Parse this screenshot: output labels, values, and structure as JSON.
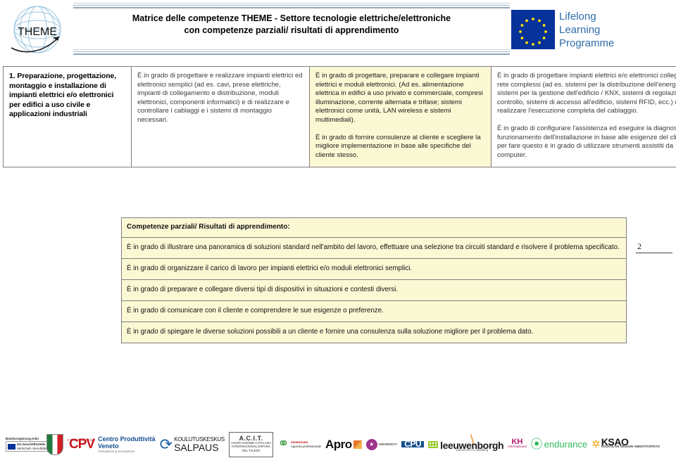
{
  "header": {
    "logo_label": "THEME",
    "title_line1": "Matrice delle competenze THEME - Settore tecnologie elettriche/elettroniche",
    "title_line2": "con competenze parziali/ risultati di apprendimento",
    "llp_line1": "Lifelong",
    "llp_line2": "Learning",
    "llp_line3": "Programme"
  },
  "matrix": {
    "row_title": "1. Preparazione, progettazione, montaggio e installazione di impianti elettrici e/o elettronici per edifici a uso civile e applicazioni industriali",
    "level1": [
      "È in grado di progettare e realizzare impianti elettrici ed elettronici semplici (ad es. cavi, prese elettriche, impianti di collegamento e distribuzione, moduli elettronici, componenti informatici) e di realizzare e controllare i cablaggi e i sistemi di montaggio necessari."
    ],
    "level2": [
      "È in grado di progettare, preparare e collegare impianti elettrici e moduli elettronici. (Ad es. alimentazione elettrica in edifici a uso privato e commerciale, compresi illuminazione, corrente alternata e trifase; sistemi elettronici come unità, LAN wireless e sistemi multimediali).",
      "È in grado di fornire consulenze al cliente e scegliere la migliore implementazione in base alle specifiche del cliente stesso."
    ],
    "level3": [
      "È in grado di progettare impianti elettrici e/o elettronici collegati in rete complessi (ad es. sistemi per la distribuzione dell'energia, sistemi per la gestione dell'edificio / KNX, sistemi di regolazione e controllo, sistemi di accesso all'edificio, sistemi RFID, ecc.) e di realizzare l'esecuzione completa del cablaggio.",
      "È in grado di configurare l'assistenza ed eseguire la diagnosi del funzionamento dell'installazione in base alle esigenze del cliente, per fare questo è in grado di utilizzare strumenti assistiti da computer."
    ]
  },
  "partial_competences": {
    "heading": "Competenze parziali/ Risultati di apprendimento:",
    "items": [
      "È in grado di illustrare una panoramica di soluzioni standard nell'ambito del lavoro, effettuare una selezione tra circuiti standard e risolvere il problema specificato.",
      "È in grado di organizzare il carico di lavoro per impianti elettrici e/o moduli elettronici semplici.",
      "È in grado di preparare e collegare diversi tipi di dispositivi in situazioni e contesti diversi.",
      "È in grado di comunicare con il cliente e comprendere le sue esigenze o preferenze.",
      "È in grado di spiegare le diverse soluzioni possibili a un cliente e fornire una consulenza sulla soluzione migliore per il problema dato."
    ]
  },
  "page_number": "2",
  "footer": {
    "logos": [
      {
        "name": "bezirksregierung-koeln-logo",
        "l1": "Bezirksregierung Köln",
        "l2": "EU-Geschäftsstelle",
        "l3": "Wirtschaft • Berufsbildung"
      },
      {
        "name": "nrw-logo",
        "l1": ""
      },
      {
        "name": "cpv-logo",
        "l1": "FONDAZIONE",
        "l2": "CPV",
        "l3": "Centro Produttività",
        "l4": "Veneto",
        "l5": "Formazione & Innovazione"
      },
      {
        "name": "salpaus-logo",
        "l1": "KOULUTUSKESKUS",
        "l2": "SALPAUS"
      },
      {
        "name": "agit-logo",
        "l1": "A.C.I.T.",
        "l2": "ASSOCIAZIONE CATALANA",
        "l3": "INTERNACIONAL ESPAÑA",
        "l4": "DEL TALENT"
      },
      {
        "name": "numerouno-logo",
        "l1": "numerouno",
        "l2": "Agenzia professionale"
      },
      {
        "name": "apro-logo",
        "l1": "Apro"
      },
      {
        "name": "university-logo",
        "l1": "UNIVERSITY"
      },
      {
        "name": "cpu-logo",
        "l1": "CPU"
      },
      {
        "name": "leeuwenborgh-logo",
        "l1": "leeuwenborgh",
        "l2": "vakmensen in opleiding"
      },
      {
        "name": "kh-logo",
        "l1": "KH",
        "l2": "Internationaal"
      },
      {
        "name": "endurance-logo",
        "l1": "endurance"
      },
      {
        "name": "ksao-logo",
        "l1": "KSAO",
        "l2": "KOUVOLAN SEUDUN AMMATTIOPISTO"
      }
    ]
  },
  "colors": {
    "highlight": "#fbf8d4",
    "eu_blue": "#07319b",
    "llp_blue": "#2e6da8",
    "border": "#7f7f7f"
  }
}
